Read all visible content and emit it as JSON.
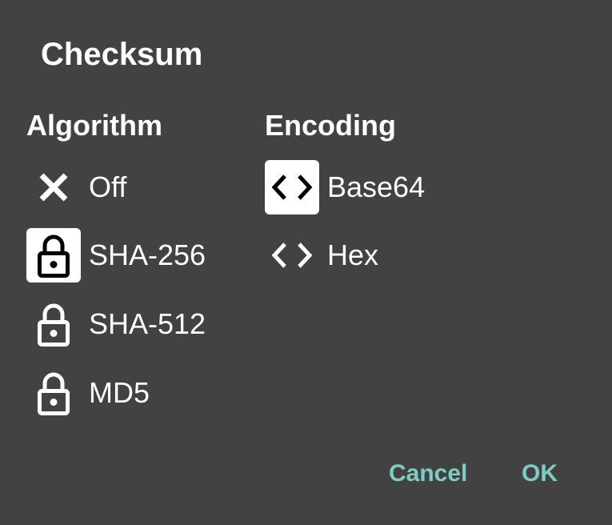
{
  "dialog": {
    "title": "Checksum"
  },
  "algorithm": {
    "heading": "Algorithm",
    "selected": "SHA-256",
    "options": [
      {
        "label": "Off",
        "icon": "close-icon"
      },
      {
        "label": "SHA-256",
        "icon": "lock-icon"
      },
      {
        "label": "SHA-512",
        "icon": "lock-icon"
      },
      {
        "label": "MD5",
        "icon": "lock-icon"
      }
    ]
  },
  "encoding": {
    "heading": "Encoding",
    "selected": "Base64",
    "options": [
      {
        "label": "Base64",
        "icon": "code-icon"
      },
      {
        "label": "Hex",
        "icon": "code-icon"
      }
    ]
  },
  "actions": {
    "cancel_label": "Cancel",
    "ok_label": "OK"
  },
  "colors": {
    "background": "#424242",
    "text": "#ffffff",
    "accent": "#80cbc4",
    "selected_icon_bg": "#ffffff"
  }
}
